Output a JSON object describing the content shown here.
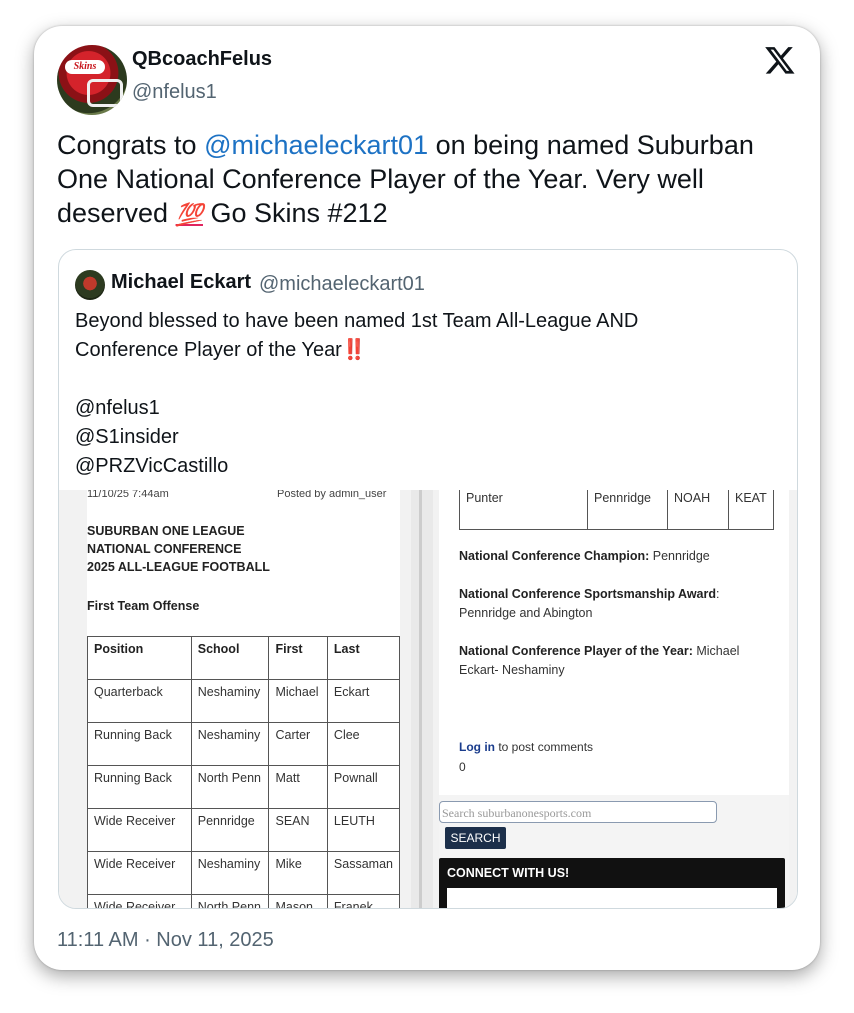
{
  "author": {
    "name": "QBcoachFelus",
    "handle": "@nfelus1",
    "avatar_text": "Skins"
  },
  "tweet": {
    "part1": "Congrats to ",
    "mention": "@michaeleckart01",
    "part2": " on being named Suburban One National Conference Player of the Year. Very well deserved ",
    "emoji": "💯",
    "part3": " Go Skins #212"
  },
  "quote": {
    "name": "Michael Eckart",
    "handle": "@michaeleckart01",
    "line1": "Beyond blessed to have been named 1st  Team All-League AND",
    "line2": "Conference Player of the Year",
    "bang": "‼️",
    "mentions": [
      "@nfelus1",
      "@S1insider",
      "@PRZVicCastillo"
    ]
  },
  "doc_left": {
    "date": "11/10/25 7:44am",
    "posted": "Posted by admin_user",
    "header": [
      "SUBURBAN ONE LEAGUE",
      "NATIONAL CONFERENCE",
      "2025 ALL-LEAGUE FOOTBALL"
    ],
    "section": "First Team Offense",
    "columns": [
      "Position",
      "School",
      "First",
      "Last"
    ],
    "rows": [
      [
        "Quarterback",
        "Neshaminy",
        "Michael",
        "Eckart"
      ],
      [
        "Running Back",
        "Neshaminy",
        "Carter",
        "Clee"
      ],
      [
        "Running Back",
        "North Penn",
        "Matt",
        "Pownall"
      ],
      [
        "Wide Receiver",
        "Pennridge",
        "SEAN",
        "LEUTH"
      ],
      [
        "Wide Receiver",
        "Neshaminy",
        "Mike",
        "Sassaman"
      ],
      [
        "Wide Receiver",
        "North Penn",
        "Mason",
        "Franek"
      ],
      [
        "",
        "",
        "",
        ""
      ]
    ]
  },
  "doc_right": {
    "row": [
      "Punter",
      "Pennridge",
      "NOAH",
      "KEAT"
    ],
    "champion_label": "National Conference Champion:",
    "champion_value": " Pennridge",
    "sportsmanship_label": "National Conference Sportsmanship Award",
    "sportsmanship_value": ": Pennridge and Abington",
    "poy_label": "National Conference Player of the Year:",
    "poy_value": " Michael Eckart- Neshaminy",
    "login_link": "Log in",
    "login_text": " to post comments",
    "comments": "0",
    "search_placeholder": "Search suburbanonesports.com",
    "search_button": "SEARCH",
    "connect": "CONNECT WITH US!"
  },
  "timestamp": "11:11 AM · Nov 11, 2025",
  "colors": {
    "mention": "#1d72c4",
    "muted": "#536471",
    "bang": "#d0021b"
  }
}
